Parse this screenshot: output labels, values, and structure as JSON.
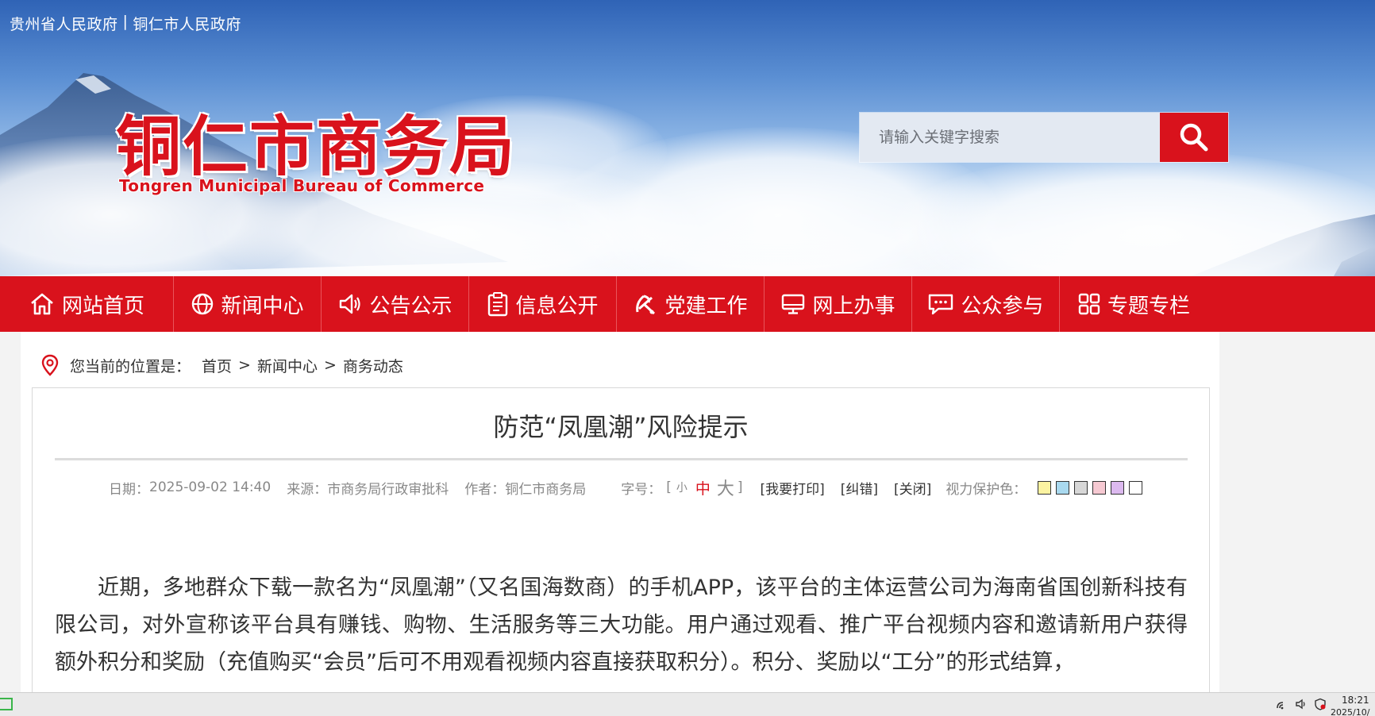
{
  "header": {
    "gov_links": [
      "贵州省人民政府",
      "|",
      "铜仁市人民政府"
    ],
    "logo_cn": "铜仁市商务局",
    "logo_en": "Tongren Municipal Bureau of Commerce",
    "search_placeholder": "请输入关键字搜索"
  },
  "nav": {
    "items": [
      {
        "label": "网站首页",
        "icon": "home-icon"
      },
      {
        "label": "新闻中心",
        "icon": "globe-icon"
      },
      {
        "label": "公告公示",
        "icon": "speaker-icon"
      },
      {
        "label": "信息公开",
        "icon": "clipboard-icon"
      },
      {
        "label": "党建工作",
        "icon": "party-emblem-icon"
      },
      {
        "label": "网上办事",
        "icon": "monitor-icon"
      },
      {
        "label": "公众参与",
        "icon": "chat-icon"
      },
      {
        "label": "专题专栏",
        "icon": "grid-icon"
      }
    ]
  },
  "breadcrumb": {
    "prefix": "您当前的位置是：",
    "items": [
      "首页",
      "新闻中心",
      "商务动态"
    ],
    "separator": ">"
  },
  "article": {
    "title": "防范“凤凰潮”风险提示",
    "meta": {
      "date_label": "日期：",
      "date": "2025-09-02 14:40",
      "source_label": "来源：",
      "source": "市商务局行政审批科",
      "author_label": "作者：",
      "author": "铜仁市商务局",
      "font_label": "字号：",
      "bracket_open": "[",
      "font_small": "小",
      "font_mid": "中",
      "font_big": "大",
      "bracket_close": "]",
      "print": "[我要打印]",
      "correct": "[纠错]",
      "close": "[关闭]",
      "eye_label": "视力保护色："
    },
    "eye_colors": [
      "#fbf3a1",
      "#a9d9ef",
      "#d7d7d7",
      "#f6c9d2",
      "#dcb9ef",
      "#ffffff"
    ],
    "paragraph": "近期，多地群众下载一款名为“凤凰潮”（又名国海数商）的手机APP，该平台的主体运营公司为海南省国创新科技有限公司，对外宣称该平台具有赚钱、购物、生活服务等三大功能。用户通过观看、推广平台视频内容和邀请新用户获得额外积分和奖励（充值购买“会员”后可不用观看视频内容直接获取积分）。积分、奖励以“工分”的形式结算，"
  },
  "colors": {
    "brand_red": "#d9121c"
  },
  "taskbar": {
    "time": "18:21",
    "date": "2025/10/"
  }
}
